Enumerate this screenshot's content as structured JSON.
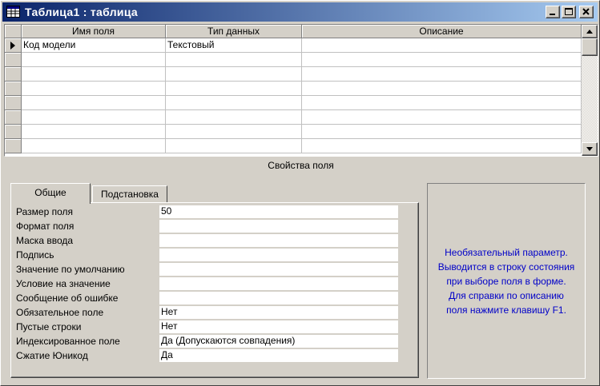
{
  "window": {
    "title": "Таблица1 : таблица"
  },
  "grid": {
    "columns": [
      "Имя поля",
      "Тип данных",
      "Описание"
    ],
    "rows": [
      {
        "field_name": "Код модели",
        "data_type": "Текстовый",
        "description": ""
      },
      {
        "field_name": "",
        "data_type": "",
        "description": ""
      },
      {
        "field_name": "",
        "data_type": "",
        "description": ""
      },
      {
        "field_name": "",
        "data_type": "",
        "description": ""
      },
      {
        "field_name": "",
        "data_type": "",
        "description": ""
      },
      {
        "field_name": "",
        "data_type": "",
        "description": ""
      },
      {
        "field_name": "",
        "data_type": "",
        "description": ""
      },
      {
        "field_name": "",
        "data_type": "",
        "description": ""
      }
    ]
  },
  "properties": {
    "section_title": "Свойства поля",
    "tabs": [
      "Общие",
      "Подстановка"
    ],
    "active_tab": "Общие",
    "items": [
      {
        "label": "Размер поля",
        "value": "50"
      },
      {
        "label": "Формат поля",
        "value": ""
      },
      {
        "label": "Маска ввода",
        "value": ""
      },
      {
        "label": "Подпись",
        "value": ""
      },
      {
        "label": "Значение по умолчанию",
        "value": ""
      },
      {
        "label": "Условие на значение",
        "value": ""
      },
      {
        "label": "Сообщение об ошибке",
        "value": ""
      },
      {
        "label": "Обязательное поле",
        "value": "Нет"
      },
      {
        "label": "Пустые строки",
        "value": "Нет"
      },
      {
        "label": "Индексированное поле",
        "value": "Да (Допускаются совпадения)"
      },
      {
        "label": "Сжатие Юникод",
        "value": "Да"
      }
    ]
  },
  "help": {
    "lines": [
      "Необязательный параметр.",
      "Выводится в строку состояния",
      "при выборе поля в форме.",
      "Для справки по описанию",
      "поля нажмите клавишу F1."
    ]
  },
  "colors": {
    "title_start": "#0a246a",
    "title_end": "#a6caf0",
    "help_text": "#0000c8",
    "face": "#d4d0c8"
  },
  "icons": {
    "title": "table-icon",
    "minimize": "minimize-icon",
    "maximize": "maximize-icon",
    "close": "close-icon",
    "row_selector": "current-row-arrow-icon",
    "scroll_up": "arrow-up-icon",
    "scroll_down": "arrow-down-icon"
  }
}
